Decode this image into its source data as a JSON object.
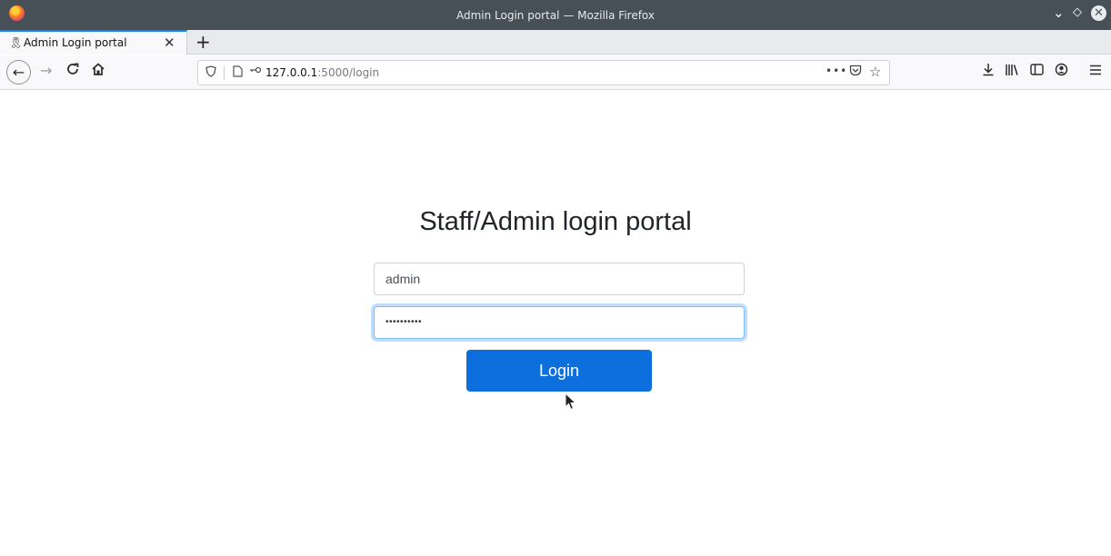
{
  "window": {
    "title": "Admin Login portal — Mozilla Firefox",
    "controls": {
      "minimize": "⌄",
      "maximize": "◇",
      "close": "✕"
    }
  },
  "tabs": [
    {
      "label": "Admin Login portal",
      "active": true
    }
  ],
  "newtab_label": "+",
  "navbar": {
    "back": "←",
    "forward": "→",
    "reload": "C",
    "home": "⌂",
    "url_host": "127.0.0.1",
    "url_rest": ":5000/login",
    "page_actions": "•••"
  },
  "page": {
    "title": "Staff/Admin login portal",
    "username_value": "admin",
    "password_value": "••••••••••",
    "login_label": "Login"
  },
  "colors": {
    "titlebar": "#475057",
    "tab_accent": "#0a84ff",
    "button": "#0d6fdd",
    "focus_ring": "#80bdff"
  },
  "icons": [
    "firefox-icon",
    "tab-favicon",
    "tab-close-icon",
    "shield-icon",
    "page-icon",
    "key-icon",
    "pocket-icon",
    "star-icon",
    "download-icon",
    "library-icon",
    "sidebar-icon",
    "account-icon",
    "menu-icon",
    "cursor-icon"
  ]
}
